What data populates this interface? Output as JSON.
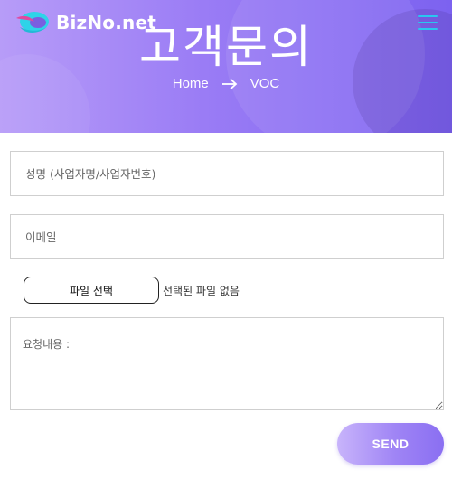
{
  "header": {
    "logo_text": "BizNo.net",
    "page_title": "고객문의",
    "breadcrumb": {
      "home": "Home",
      "current": "VOC"
    }
  },
  "form": {
    "name_placeholder": "성명 (사업자명/사업자번호)",
    "email_placeholder": "이메일",
    "file_button_label": "파일 선택",
    "file_status": "선택된 파일 없음",
    "request_placeholder": "요청내용 :",
    "send_label": "SEND"
  },
  "colors": {
    "hero_gradient_start": "#b79cf8",
    "hero_gradient_end": "#7c62f0",
    "menu_icon": "#29c6f0",
    "send_gradient_start": "#c8b4fb",
    "send_gradient_end": "#8a6ff2"
  },
  "icons": {
    "logo": "logo-icon",
    "menu": "hamburger-menu-icon",
    "breadcrumb_separator": "arrow-right-icon"
  }
}
